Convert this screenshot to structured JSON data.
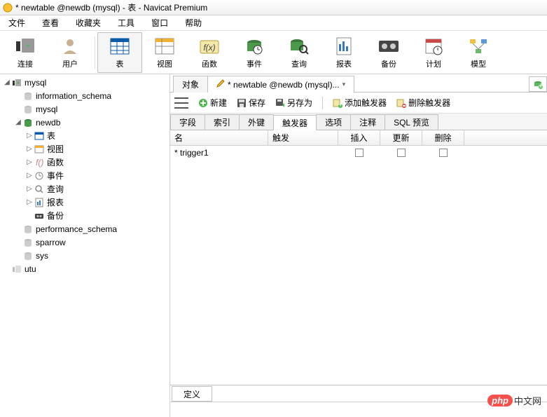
{
  "title": "* newtable @newdb (mysql) - 表 - Navicat Premium",
  "menu": [
    "文件",
    "查看",
    "收藏夹",
    "工具",
    "窗口",
    "帮助"
  ],
  "toolbar": [
    {
      "id": "connect",
      "label": "连接"
    },
    {
      "id": "user",
      "label": "用户"
    },
    {
      "id": "table",
      "label": "表",
      "active": true
    },
    {
      "id": "view",
      "label": "视图"
    },
    {
      "id": "function",
      "label": "函数"
    },
    {
      "id": "event",
      "label": "事件"
    },
    {
      "id": "query",
      "label": "查询"
    },
    {
      "id": "report",
      "label": "报表"
    },
    {
      "id": "backup",
      "label": "备份"
    },
    {
      "id": "schedule",
      "label": "计划"
    },
    {
      "id": "model",
      "label": "模型"
    }
  ],
  "tree": [
    {
      "depth": 0,
      "twist": "◢",
      "icon": "db-conn",
      "label": "mysql"
    },
    {
      "depth": 1,
      "twist": "",
      "icon": "db",
      "label": "information_schema"
    },
    {
      "depth": 1,
      "twist": "",
      "icon": "db",
      "label": "mysql"
    },
    {
      "depth": 1,
      "twist": "◢",
      "icon": "db-open",
      "label": "newdb"
    },
    {
      "depth": 2,
      "twist": "▷",
      "icon": "table",
      "label": "表"
    },
    {
      "depth": 2,
      "twist": "▷",
      "icon": "view",
      "label": "视图"
    },
    {
      "depth": 2,
      "twist": "▷",
      "icon": "func",
      "label": "函数"
    },
    {
      "depth": 2,
      "twist": "▷",
      "icon": "event",
      "label": "事件"
    },
    {
      "depth": 2,
      "twist": "▷",
      "icon": "query",
      "label": "查询"
    },
    {
      "depth": 2,
      "twist": "▷",
      "icon": "report",
      "label": "报表"
    },
    {
      "depth": 2,
      "twist": "",
      "icon": "backup",
      "label": "备份"
    },
    {
      "depth": 1,
      "twist": "",
      "icon": "db",
      "label": "performance_schema"
    },
    {
      "depth": 1,
      "twist": "",
      "icon": "db",
      "label": "sparrow"
    },
    {
      "depth": 1,
      "twist": "",
      "icon": "db",
      "label": "sys"
    },
    {
      "depth": 0,
      "twist": "",
      "icon": "db-conn-off",
      "label": "utu"
    }
  ],
  "tabs": {
    "list": [
      {
        "label": "对象",
        "active": false
      },
      {
        "label": "* newtable @newdb (mysql)...",
        "active": true
      }
    ]
  },
  "actions": {
    "new": "新建",
    "save": "保存",
    "saveas": "另存为",
    "addtrig": "添加触发器",
    "deltrig": "删除触发器"
  },
  "subtabs": [
    "字段",
    "索引",
    "外键",
    "触发器",
    "选项",
    "注释",
    "SQL 预览"
  ],
  "subtab_active": 3,
  "grid": {
    "head": [
      "名",
      "触发",
      "插入",
      "更新",
      "删除"
    ],
    "rows": [
      {
        "marker": "*",
        "name": "trigger1"
      }
    ]
  },
  "bottom_tab": "定义",
  "watermark": {
    "brand": "php",
    "text": "中文网"
  }
}
